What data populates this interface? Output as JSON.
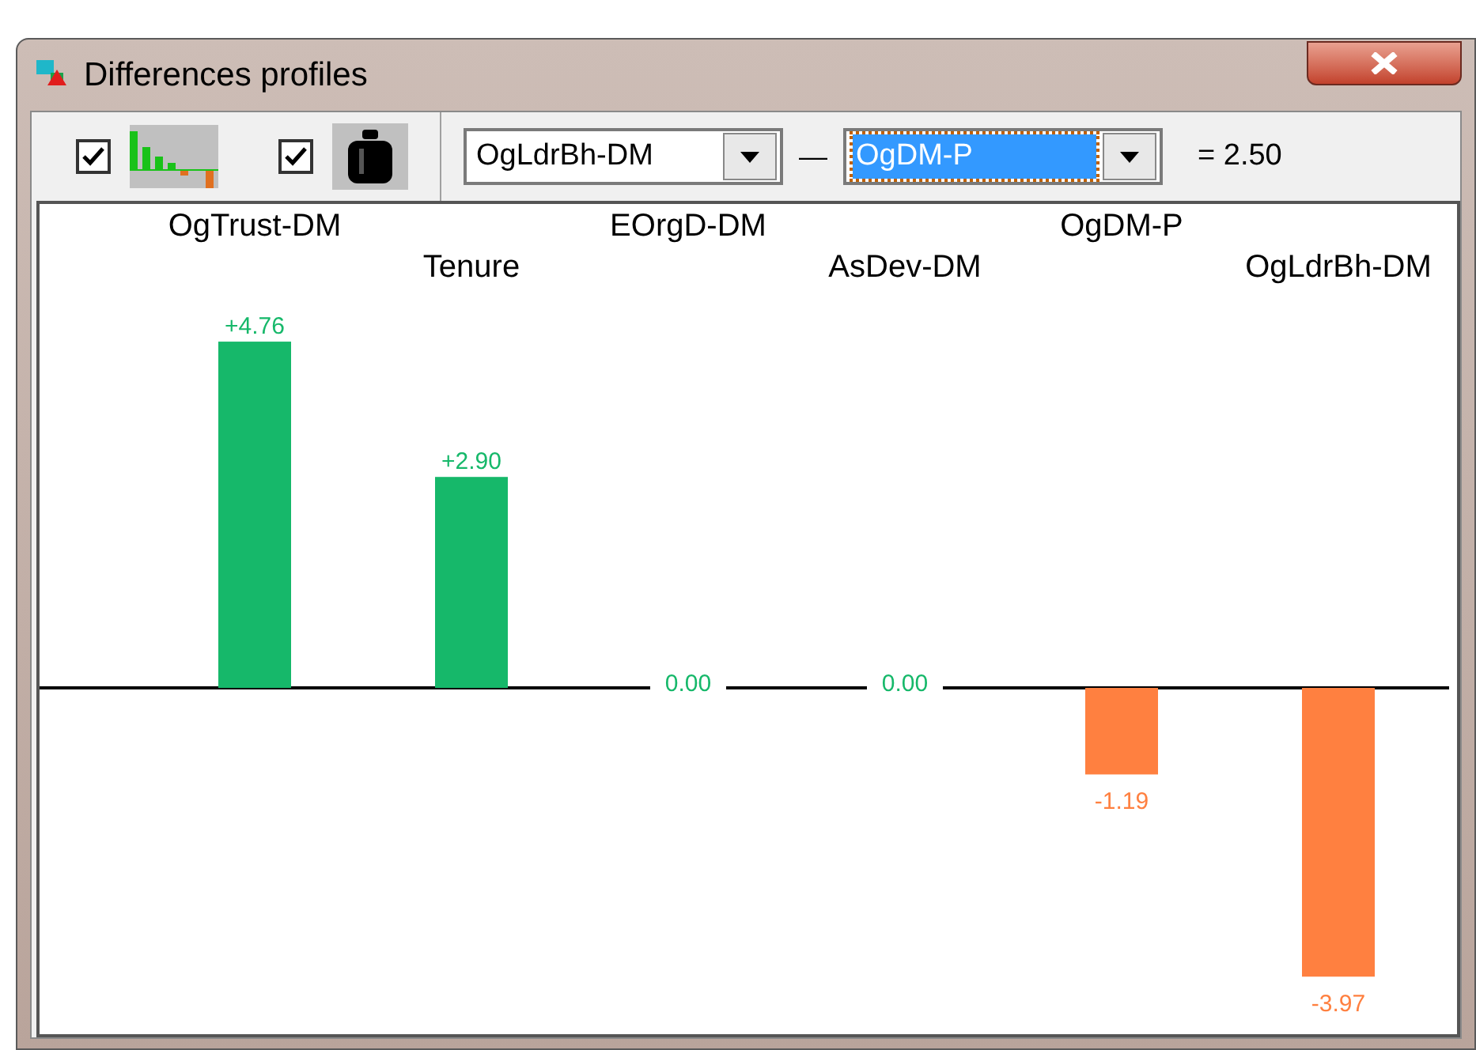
{
  "window": {
    "title": "Differences profiles"
  },
  "toolbar": {
    "toggles": [
      {
        "kind": "chart",
        "checked": true
      },
      {
        "kind": "weight",
        "checked": true
      }
    ],
    "first_profile": {
      "value": "OgLdrBh-DM"
    },
    "operator": "—",
    "second_profile": {
      "value": "OgDM-P",
      "selected": true
    },
    "result": "= 2.50"
  },
  "chart": {
    "chart_data": {
      "type": "bar",
      "categories": [
        "OgTrust-DM",
        "Tenure",
        "EOrgD-DM",
        "AsDev-DM",
        "OgDM-P",
        "OgLdrBh-DM"
      ],
      "series": [
        {
          "values": [
            4.76,
            2.9,
            0.0,
            0.0,
            -1.19,
            -3.97
          ],
          "value_labels": [
            "+4.76",
            "+2.90",
            "0.00",
            "0.00",
            "-1.19",
            "-3.97"
          ]
        }
      ],
      "data_labels": true
    }
  }
}
